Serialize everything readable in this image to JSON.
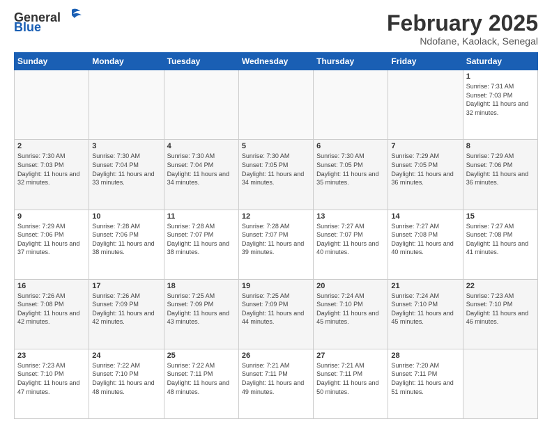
{
  "logo": {
    "text_general": "General",
    "text_blue": "Blue"
  },
  "header": {
    "title": "February 2025",
    "subtitle": "Ndofane, Kaolack, Senegal"
  },
  "columns": [
    "Sunday",
    "Monday",
    "Tuesday",
    "Wednesday",
    "Thursday",
    "Friday",
    "Saturday"
  ],
  "weeks": [
    {
      "days": [
        {
          "num": "",
          "info": ""
        },
        {
          "num": "",
          "info": ""
        },
        {
          "num": "",
          "info": ""
        },
        {
          "num": "",
          "info": ""
        },
        {
          "num": "",
          "info": ""
        },
        {
          "num": "",
          "info": ""
        },
        {
          "num": "1",
          "info": "Sunrise: 7:31 AM\nSunset: 7:03 PM\nDaylight: 11 hours and 32 minutes."
        }
      ]
    },
    {
      "days": [
        {
          "num": "2",
          "info": "Sunrise: 7:30 AM\nSunset: 7:03 PM\nDaylight: 11 hours and 32 minutes."
        },
        {
          "num": "3",
          "info": "Sunrise: 7:30 AM\nSunset: 7:04 PM\nDaylight: 11 hours and 33 minutes."
        },
        {
          "num": "4",
          "info": "Sunrise: 7:30 AM\nSunset: 7:04 PM\nDaylight: 11 hours and 34 minutes."
        },
        {
          "num": "5",
          "info": "Sunrise: 7:30 AM\nSunset: 7:05 PM\nDaylight: 11 hours and 34 minutes."
        },
        {
          "num": "6",
          "info": "Sunrise: 7:30 AM\nSunset: 7:05 PM\nDaylight: 11 hours and 35 minutes."
        },
        {
          "num": "7",
          "info": "Sunrise: 7:29 AM\nSunset: 7:05 PM\nDaylight: 11 hours and 36 minutes."
        },
        {
          "num": "8",
          "info": "Sunrise: 7:29 AM\nSunset: 7:06 PM\nDaylight: 11 hours and 36 minutes."
        }
      ]
    },
    {
      "days": [
        {
          "num": "9",
          "info": "Sunrise: 7:29 AM\nSunset: 7:06 PM\nDaylight: 11 hours and 37 minutes."
        },
        {
          "num": "10",
          "info": "Sunrise: 7:28 AM\nSunset: 7:06 PM\nDaylight: 11 hours and 38 minutes."
        },
        {
          "num": "11",
          "info": "Sunrise: 7:28 AM\nSunset: 7:07 PM\nDaylight: 11 hours and 38 minutes."
        },
        {
          "num": "12",
          "info": "Sunrise: 7:28 AM\nSunset: 7:07 PM\nDaylight: 11 hours and 39 minutes."
        },
        {
          "num": "13",
          "info": "Sunrise: 7:27 AM\nSunset: 7:07 PM\nDaylight: 11 hours and 40 minutes."
        },
        {
          "num": "14",
          "info": "Sunrise: 7:27 AM\nSunset: 7:08 PM\nDaylight: 11 hours and 40 minutes."
        },
        {
          "num": "15",
          "info": "Sunrise: 7:27 AM\nSunset: 7:08 PM\nDaylight: 11 hours and 41 minutes."
        }
      ]
    },
    {
      "days": [
        {
          "num": "16",
          "info": "Sunrise: 7:26 AM\nSunset: 7:08 PM\nDaylight: 11 hours and 42 minutes."
        },
        {
          "num": "17",
          "info": "Sunrise: 7:26 AM\nSunset: 7:09 PM\nDaylight: 11 hours and 42 minutes."
        },
        {
          "num": "18",
          "info": "Sunrise: 7:25 AM\nSunset: 7:09 PM\nDaylight: 11 hours and 43 minutes."
        },
        {
          "num": "19",
          "info": "Sunrise: 7:25 AM\nSunset: 7:09 PM\nDaylight: 11 hours and 44 minutes."
        },
        {
          "num": "20",
          "info": "Sunrise: 7:24 AM\nSunset: 7:10 PM\nDaylight: 11 hours and 45 minutes."
        },
        {
          "num": "21",
          "info": "Sunrise: 7:24 AM\nSunset: 7:10 PM\nDaylight: 11 hours and 45 minutes."
        },
        {
          "num": "22",
          "info": "Sunrise: 7:23 AM\nSunset: 7:10 PM\nDaylight: 11 hours and 46 minutes."
        }
      ]
    },
    {
      "days": [
        {
          "num": "23",
          "info": "Sunrise: 7:23 AM\nSunset: 7:10 PM\nDaylight: 11 hours and 47 minutes."
        },
        {
          "num": "24",
          "info": "Sunrise: 7:22 AM\nSunset: 7:10 PM\nDaylight: 11 hours and 48 minutes."
        },
        {
          "num": "25",
          "info": "Sunrise: 7:22 AM\nSunset: 7:11 PM\nDaylight: 11 hours and 48 minutes."
        },
        {
          "num": "26",
          "info": "Sunrise: 7:21 AM\nSunset: 7:11 PM\nDaylight: 11 hours and 49 minutes."
        },
        {
          "num": "27",
          "info": "Sunrise: 7:21 AM\nSunset: 7:11 PM\nDaylight: 11 hours and 50 minutes."
        },
        {
          "num": "28",
          "info": "Sunrise: 7:20 AM\nSunset: 7:11 PM\nDaylight: 11 hours and 51 minutes."
        },
        {
          "num": "",
          "info": ""
        }
      ]
    }
  ]
}
